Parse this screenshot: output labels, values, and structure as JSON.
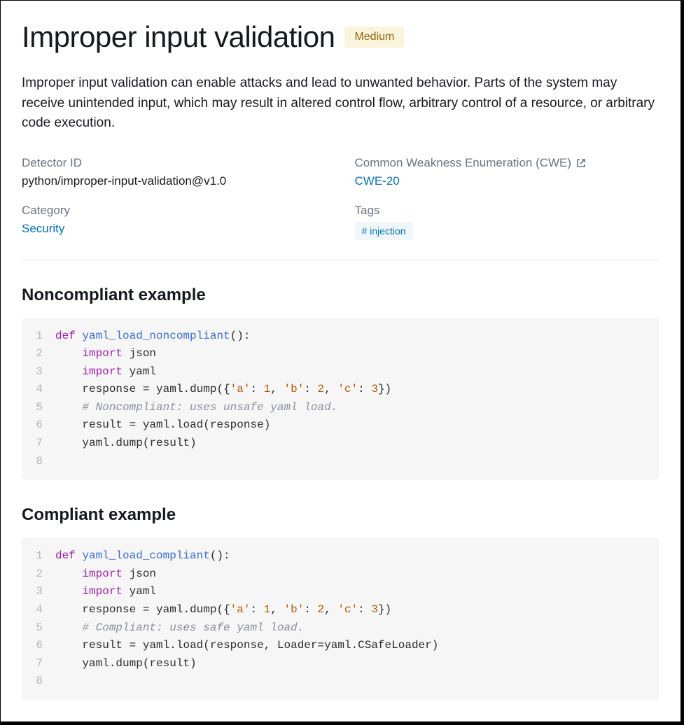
{
  "title": "Improper input validation",
  "severity": "Medium",
  "description": "Improper input validation can enable attacks and lead to unwanted behavior. Parts of the system may receive unintended input, which may result in altered control flow, arbitrary control of a resource, or arbitrary code execution.",
  "meta": {
    "detector_id_label": "Detector ID",
    "detector_id_value": "python/improper-input-validation@v1.0",
    "cwe_label": "Common Weakness Enumeration (CWE)",
    "cwe_link": "CWE-20",
    "category_label": "Category",
    "category_link": "Security",
    "tags_label": "Tags",
    "tags": [
      "# injection"
    ]
  },
  "sections": {
    "noncompliant_heading": "Noncompliant example",
    "compliant_heading": "Compliant example"
  },
  "code": {
    "noncompliant": [
      {
        "n": "1",
        "tokens": [
          [
            "kw",
            "def "
          ],
          [
            "fn",
            "yaml_load_noncompliant"
          ],
          [
            "op",
            "():"
          ]
        ]
      },
      {
        "n": "2",
        "tokens": [
          [
            "id",
            "    "
          ],
          [
            "kw",
            "import"
          ],
          [
            "id",
            " json"
          ]
        ]
      },
      {
        "n": "3",
        "tokens": [
          [
            "id",
            "    "
          ],
          [
            "kw",
            "import"
          ],
          [
            "id",
            " yaml"
          ]
        ]
      },
      {
        "n": "4",
        "tokens": [
          [
            "id",
            "    response "
          ],
          [
            "op",
            "="
          ],
          [
            "id",
            " yaml"
          ],
          [
            "op",
            "."
          ],
          [
            "id",
            "dump"
          ],
          [
            "op",
            "({"
          ],
          [
            "str",
            "'a'"
          ],
          [
            "op",
            ": "
          ],
          [
            "num",
            "1"
          ],
          [
            "op",
            ", "
          ],
          [
            "str",
            "'b'"
          ],
          [
            "op",
            ": "
          ],
          [
            "num",
            "2"
          ],
          [
            "op",
            ", "
          ],
          [
            "str",
            "'c'"
          ],
          [
            "op",
            ": "
          ],
          [
            "num",
            "3"
          ],
          [
            "op",
            "})"
          ]
        ]
      },
      {
        "n": "5",
        "tokens": [
          [
            "id",
            "    "
          ],
          [
            "cm",
            "# Noncompliant: uses unsafe yaml load."
          ]
        ]
      },
      {
        "n": "6",
        "tokens": [
          [
            "id",
            "    result "
          ],
          [
            "op",
            "="
          ],
          [
            "id",
            " yaml"
          ],
          [
            "op",
            "."
          ],
          [
            "id",
            "load"
          ],
          [
            "op",
            "("
          ],
          [
            "id",
            "response"
          ],
          [
            "op",
            ")"
          ]
        ]
      },
      {
        "n": "7",
        "tokens": [
          [
            "id",
            "    yaml"
          ],
          [
            "op",
            "."
          ],
          [
            "id",
            "dump"
          ],
          [
            "op",
            "("
          ],
          [
            "id",
            "result"
          ],
          [
            "op",
            ")"
          ]
        ]
      },
      {
        "n": "8",
        "tokens": []
      }
    ],
    "compliant": [
      {
        "n": "1",
        "tokens": [
          [
            "kw",
            "def "
          ],
          [
            "fn",
            "yaml_load_compliant"
          ],
          [
            "op",
            "():"
          ]
        ]
      },
      {
        "n": "2",
        "tokens": [
          [
            "id",
            "    "
          ],
          [
            "kw",
            "import"
          ],
          [
            "id",
            " json"
          ]
        ]
      },
      {
        "n": "3",
        "tokens": [
          [
            "id",
            "    "
          ],
          [
            "kw",
            "import"
          ],
          [
            "id",
            " yaml"
          ]
        ]
      },
      {
        "n": "4",
        "tokens": [
          [
            "id",
            "    response "
          ],
          [
            "op",
            "="
          ],
          [
            "id",
            " yaml"
          ],
          [
            "op",
            "."
          ],
          [
            "id",
            "dump"
          ],
          [
            "op",
            "({"
          ],
          [
            "str",
            "'a'"
          ],
          [
            "op",
            ": "
          ],
          [
            "num",
            "1"
          ],
          [
            "op",
            ", "
          ],
          [
            "str",
            "'b'"
          ],
          [
            "op",
            ": "
          ],
          [
            "num",
            "2"
          ],
          [
            "op",
            ", "
          ],
          [
            "str",
            "'c'"
          ],
          [
            "op",
            ": "
          ],
          [
            "num",
            "3"
          ],
          [
            "op",
            "})"
          ]
        ]
      },
      {
        "n": "5",
        "tokens": [
          [
            "id",
            "    "
          ],
          [
            "cm",
            "# Compliant: uses safe yaml load."
          ]
        ]
      },
      {
        "n": "6",
        "tokens": [
          [
            "id",
            "    result "
          ],
          [
            "op",
            "="
          ],
          [
            "id",
            " yaml"
          ],
          [
            "op",
            "."
          ],
          [
            "id",
            "load"
          ],
          [
            "op",
            "("
          ],
          [
            "id",
            "response"
          ],
          [
            "op",
            ", "
          ],
          [
            "id",
            "Loader"
          ],
          [
            "op",
            "="
          ],
          [
            "id",
            "yaml"
          ],
          [
            "op",
            "."
          ],
          [
            "id",
            "CSafeLoader"
          ],
          [
            "op",
            ")"
          ]
        ]
      },
      {
        "n": "7",
        "tokens": [
          [
            "id",
            "    yaml"
          ],
          [
            "op",
            "."
          ],
          [
            "id",
            "dump"
          ],
          [
            "op",
            "("
          ],
          [
            "id",
            "result"
          ],
          [
            "op",
            ")"
          ]
        ]
      },
      {
        "n": "8",
        "tokens": []
      }
    ]
  }
}
